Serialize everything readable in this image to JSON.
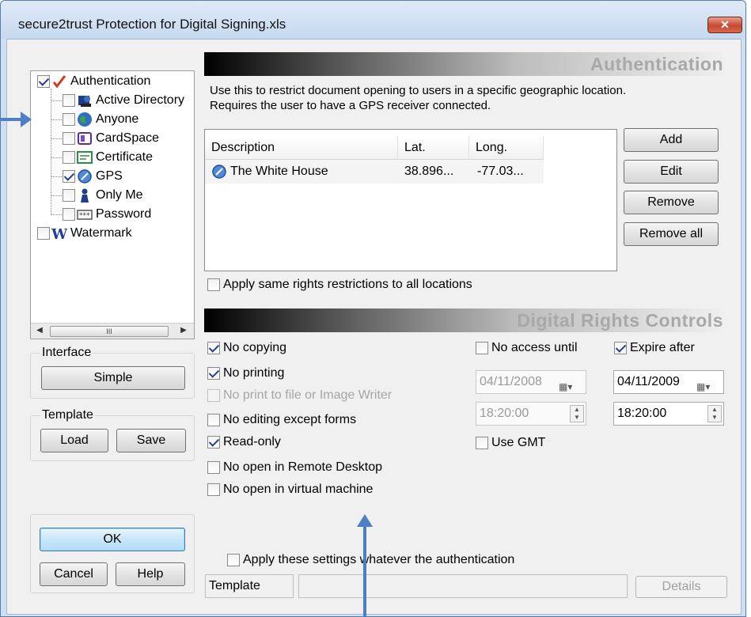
{
  "window": {
    "title": "secure2trust Protection for Digital Signing.xls",
    "close_glyph": "✕"
  },
  "tree": {
    "items": [
      {
        "label": "Authentication",
        "checked": true,
        "icon": "checkmark-icon"
      },
      {
        "label": "Active Directory",
        "checked": false,
        "icon": "active-directory-icon"
      },
      {
        "label": "Anyone",
        "checked": false,
        "icon": "globe-icon"
      },
      {
        "label": "CardSpace",
        "checked": false,
        "icon": "cardspace-icon"
      },
      {
        "label": "Certificate",
        "checked": false,
        "icon": "certificate-icon"
      },
      {
        "label": "GPS",
        "checked": true,
        "icon": "gps-icon"
      },
      {
        "label": "Only Me",
        "checked": false,
        "icon": "person-icon"
      },
      {
        "label": "Password",
        "checked": false,
        "icon": "password-icon"
      },
      {
        "label": "Watermark",
        "checked": false,
        "icon": "watermark-icon"
      }
    ],
    "scroll_thumb_grip": "III",
    "scroll_left": "◀",
    "scroll_right": "▶"
  },
  "interface_group": {
    "title": "Interface",
    "simple_button": "Simple"
  },
  "template_group": {
    "title": "Template",
    "load_button": "Load",
    "save_button": "Save"
  },
  "footer_buttons": {
    "ok": "OK",
    "cancel": "Cancel",
    "help": "Help",
    "details": "Details"
  },
  "authentication": {
    "header": "Authentication",
    "description_line1": "Use this to restrict document opening to users in a specific geographic location.",
    "description_line2": "Requires the user to have a GPS receiver connected.",
    "columns": [
      "Description",
      "Lat.",
      "Long."
    ],
    "rows": [
      {
        "description": "The White House",
        "lat": "38.896...",
        "long": "-77.03..."
      }
    ],
    "buttons": {
      "add": "Add",
      "edit": "Edit",
      "remove": "Remove",
      "remove_all": "Remove all"
    },
    "apply_same_rights": {
      "label": "Apply same rights restrictions to all locations",
      "checked": false
    }
  },
  "rights": {
    "header": "Digital Rights Controls",
    "options": [
      {
        "label": "No copying",
        "checked": true,
        "disabled": false
      },
      {
        "label": "No printing",
        "checked": true,
        "disabled": false
      },
      {
        "label": "No print to file or Image Writer",
        "checked": false,
        "disabled": true
      },
      {
        "label": "No editing except forms",
        "checked": false,
        "disabled": false
      },
      {
        "label": "Read-only",
        "checked": true,
        "disabled": false
      },
      {
        "label": "No open in Remote Desktop",
        "checked": false,
        "disabled": false
      },
      {
        "label": "No open in virtual machine",
        "checked": false,
        "disabled": false
      }
    ],
    "no_access_until": {
      "label": "No access until",
      "checked": false,
      "date": "04/11/2008",
      "time": "18:20:00"
    },
    "expire_after": {
      "label": "Expire after",
      "checked": true,
      "date": "04/11/2009",
      "time": "18:20:00"
    },
    "use_gmt": {
      "label": "Use GMT",
      "checked": false
    },
    "apply_settings": {
      "label": "Apply these settings whatever the authentication",
      "checked": false
    }
  },
  "status_bar": {
    "template_label": "Template",
    "template_value": ""
  },
  "colors": {
    "annotation_arrow": "#4d7fc9",
    "default_button": "#c8e6fa"
  }
}
